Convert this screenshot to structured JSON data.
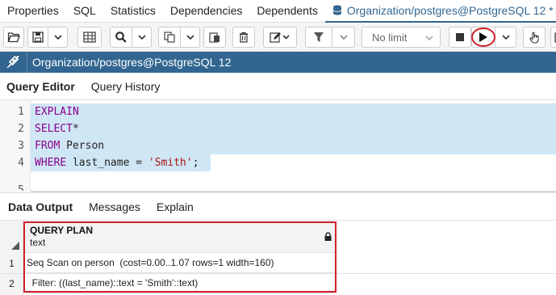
{
  "tabs": [
    {
      "label": "Properties"
    },
    {
      "label": "SQL"
    },
    {
      "label": "Statistics"
    },
    {
      "label": "Dependencies"
    },
    {
      "label": "Dependents"
    },
    {
      "label": "Organization/postgres@PostgreSQL 12 *"
    }
  ],
  "toolbar": {
    "limit_label": "No limit"
  },
  "connection": {
    "title": "Organization/postgres@PostgreSQL 12"
  },
  "query_tabs": [
    {
      "label": "Query Editor"
    },
    {
      "label": "Query History"
    }
  ],
  "editor": {
    "line_numbers": [
      "1",
      "2",
      "3",
      "4",
      "5"
    ],
    "lines": [
      {
        "kw": "EXPLAIN",
        "rest": ""
      },
      {
        "kw": "SELECT",
        "rest": "*"
      },
      {
        "kw": "FROM",
        "rest": " Person"
      },
      {
        "kw": "WHERE",
        "rest": " last_name = ",
        "str": "'Smith'",
        "tail": ";"
      }
    ]
  },
  "output_tabs": [
    {
      "label": "Data Output"
    },
    {
      "label": "Messages"
    },
    {
      "label": "Explain"
    }
  ],
  "grid": {
    "column_name": "QUERY PLAN",
    "column_type": "text",
    "rows": [
      {
        "num": "1",
        "value": "Seq Scan on person  (cost=0.00..1.07 rows=1 width=160)"
      },
      {
        "num": "2",
        "value": "  Filter: ((last_name)::text = 'Smith'::text)"
      }
    ]
  },
  "colors": {
    "accent": "#326690",
    "highlight": "#d21f2a"
  }
}
